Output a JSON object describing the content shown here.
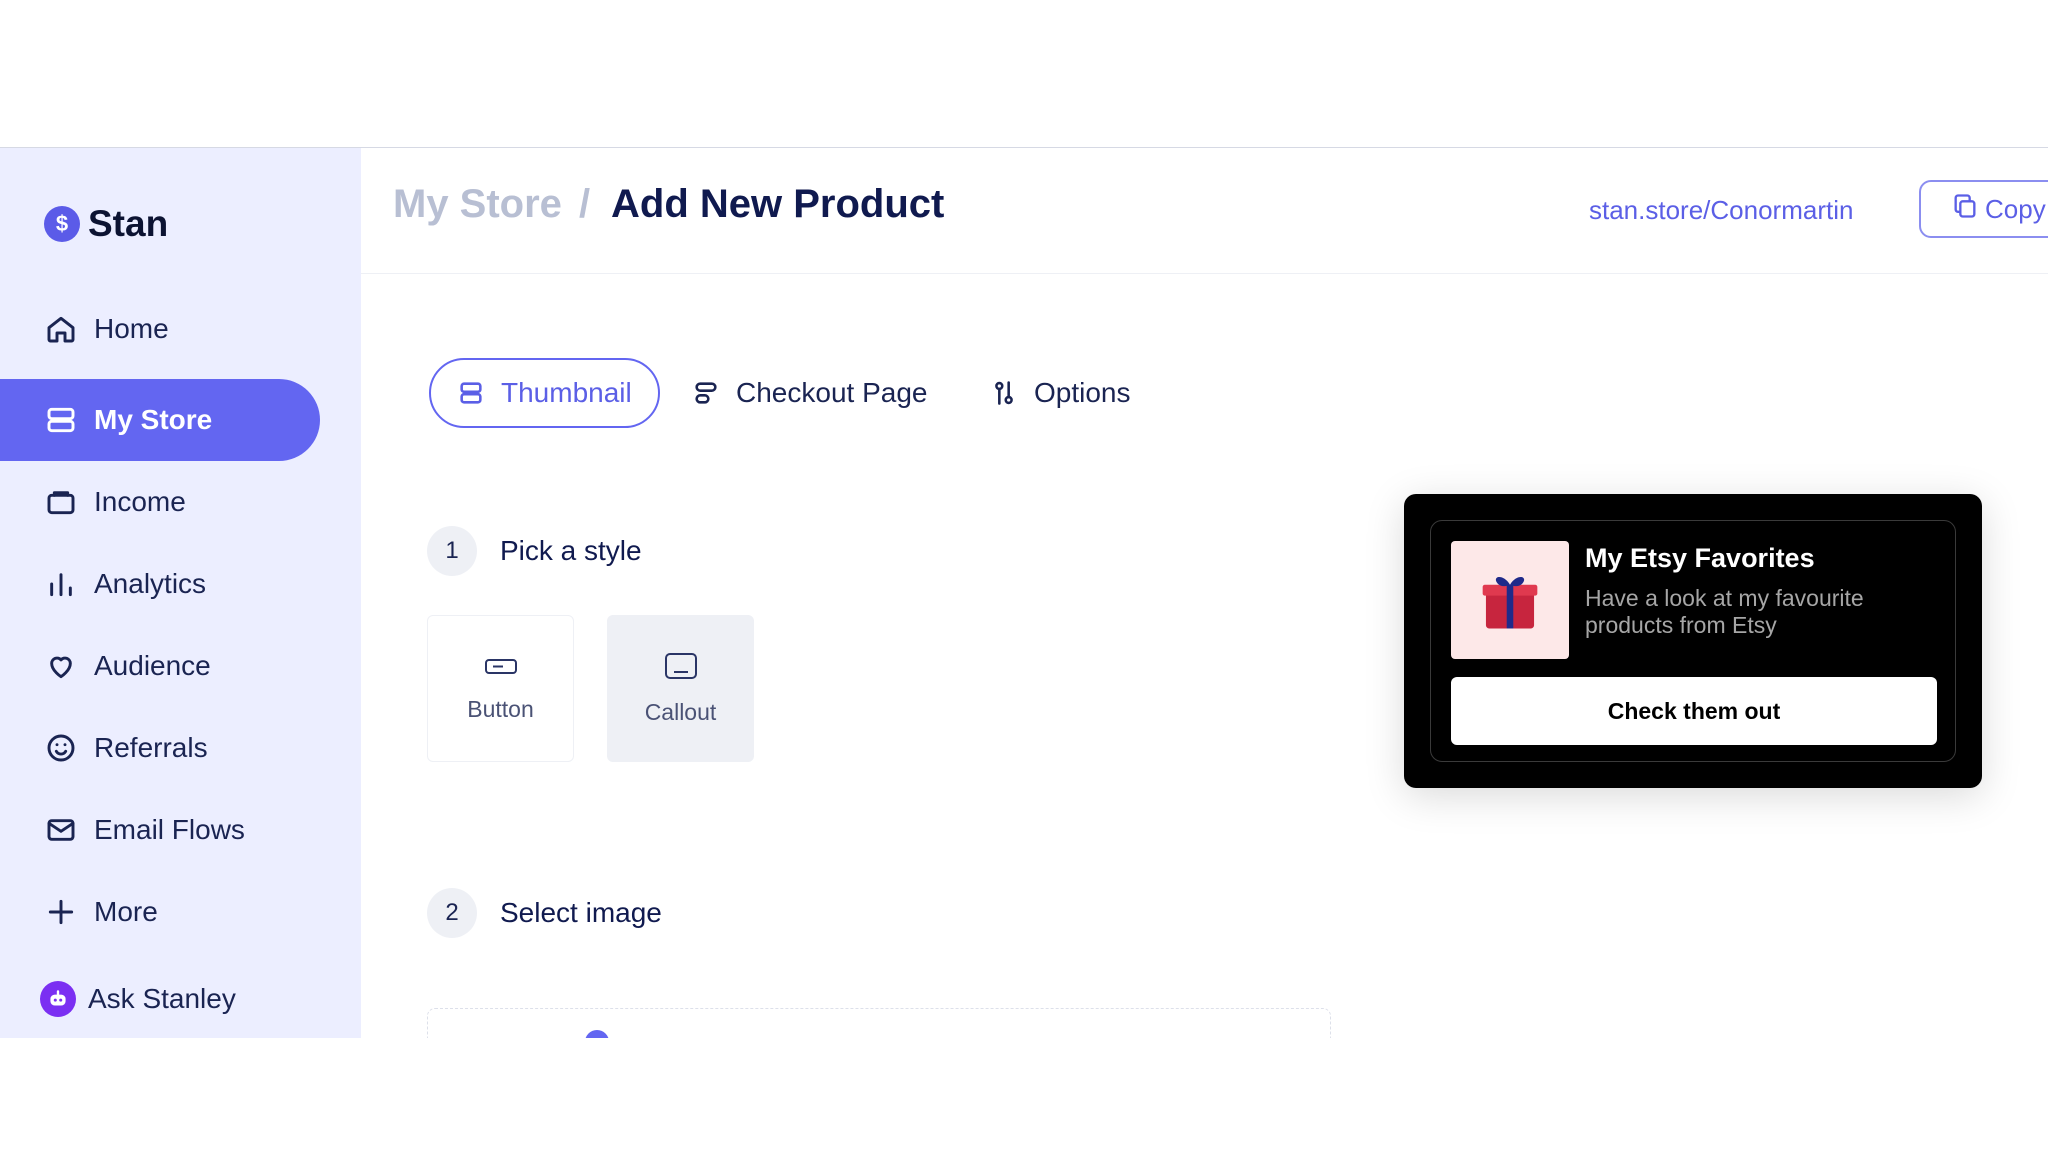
{
  "logo": {
    "text": "Stan",
    "icon": "dollar-coin-icon"
  },
  "sidebar": {
    "items": [
      {
        "label": "Home",
        "icon": "home-icon"
      },
      {
        "label": "My Store",
        "icon": "store-icon",
        "active": true
      },
      {
        "label": "Income",
        "icon": "wallet-icon"
      },
      {
        "label": "Analytics",
        "icon": "bar-chart-icon"
      },
      {
        "label": "Audience",
        "icon": "heart-icon"
      },
      {
        "label": "Referrals",
        "icon": "smile-icon"
      },
      {
        "label": "Email Flows",
        "icon": "mail-icon"
      },
      {
        "label": "More",
        "icon": "plus-icon"
      }
    ],
    "ask": {
      "label": "Ask Stanley",
      "icon": "robot-icon"
    }
  },
  "header": {
    "breadcrumb_parent": "My Store",
    "breadcrumb_sep": "/",
    "breadcrumb_current": "Add New Product",
    "store_link": "stan.store/Conormartin",
    "copy_label": "Copy"
  },
  "tabs": [
    {
      "label": "Thumbnail",
      "active": true
    },
    {
      "label": "Checkout Page"
    },
    {
      "label": "Options"
    }
  ],
  "steps": [
    {
      "number": "1",
      "label": "Pick a style"
    },
    {
      "number": "2",
      "label": "Select image"
    }
  ],
  "styles": [
    {
      "label": "Button"
    },
    {
      "label": "Callout",
      "selected": true
    }
  ],
  "preview": {
    "title": "My Etsy Favorites",
    "description": "Have a look at my favourite products from Etsy",
    "button": "Check them out",
    "image": "gift-box-icon"
  },
  "colors": {
    "accent": "#6366f1",
    "sidebar_bg": "#eceeff",
    "preview_bg": "#000000"
  }
}
